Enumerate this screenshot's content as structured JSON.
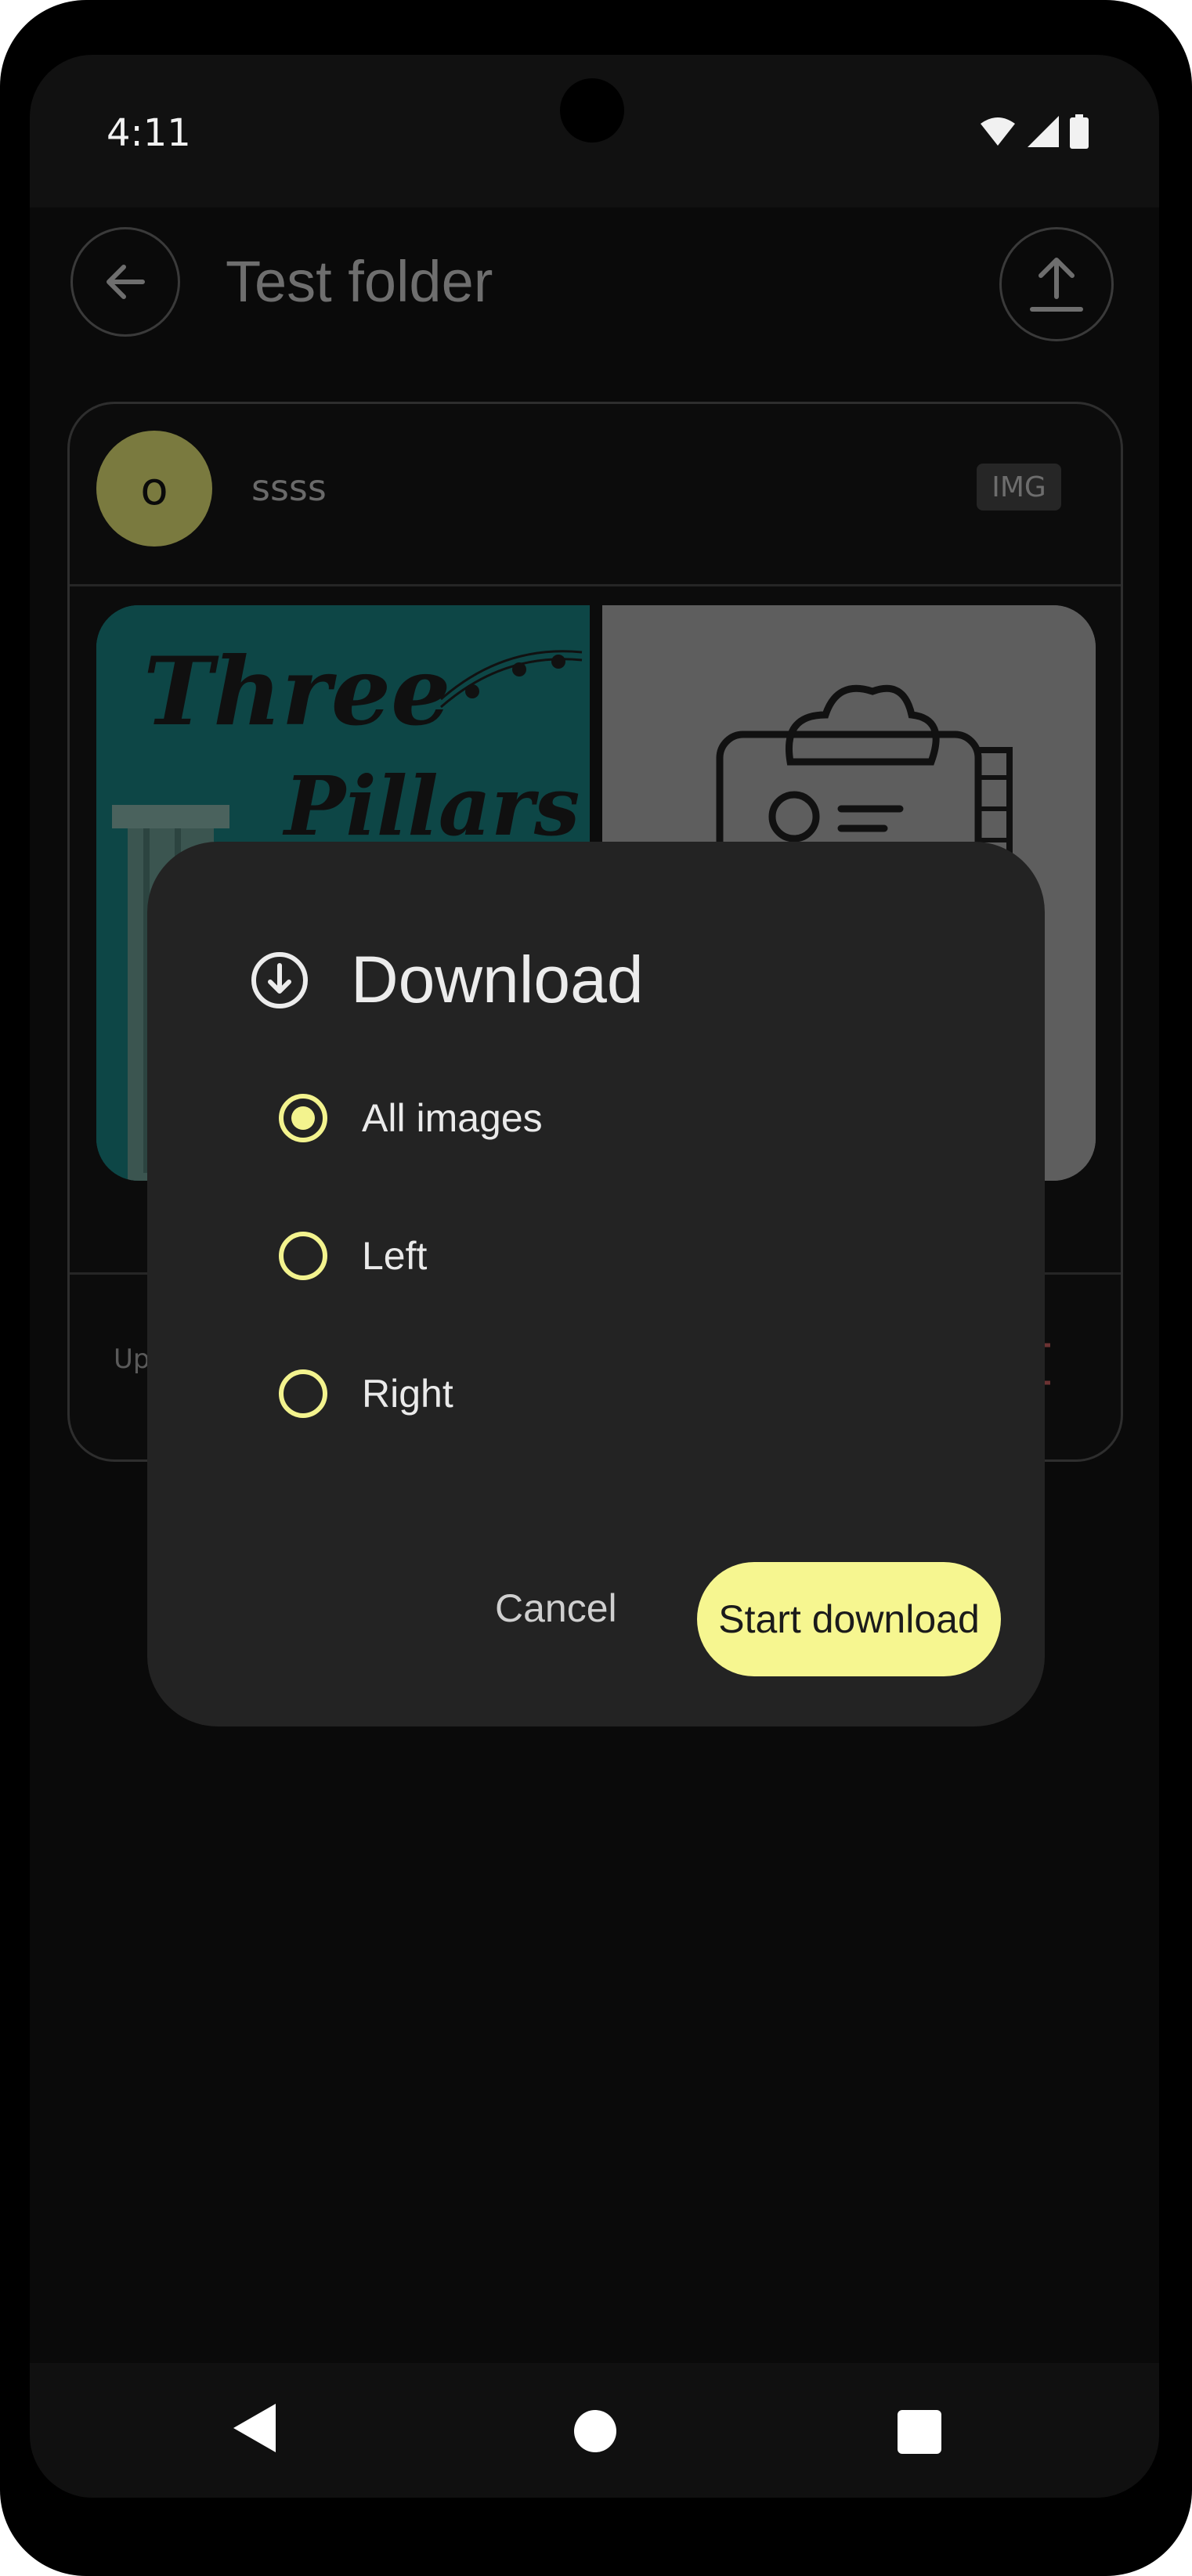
{
  "status_bar": {
    "time": "4:11"
  },
  "app_bar": {
    "title": "Test folder"
  },
  "card": {
    "avatar_letter": "o",
    "name": "ssss",
    "type_badge": "IMG",
    "left_image_text_line1": "Three",
    "left_image_text_line2": "Pillars",
    "footer_text_partial": "Up"
  },
  "dialog": {
    "title": "Download",
    "options": [
      {
        "label": "All images",
        "selected": true
      },
      {
        "label": "Left",
        "selected": false
      },
      {
        "label": "Right",
        "selected": false
      }
    ],
    "cancel_label": "Cancel",
    "confirm_label": "Start download"
  },
  "colors": {
    "accent": "#f6f690",
    "dialog_background": "#232323",
    "screen_background": "#0a0a0a"
  },
  "icons": {
    "back": "arrow-left-icon",
    "upload": "upload-icon",
    "dialog": "download-circle-icon",
    "wifi": "wifi-icon",
    "signal": "cell-signal-icon",
    "battery": "battery-icon"
  }
}
